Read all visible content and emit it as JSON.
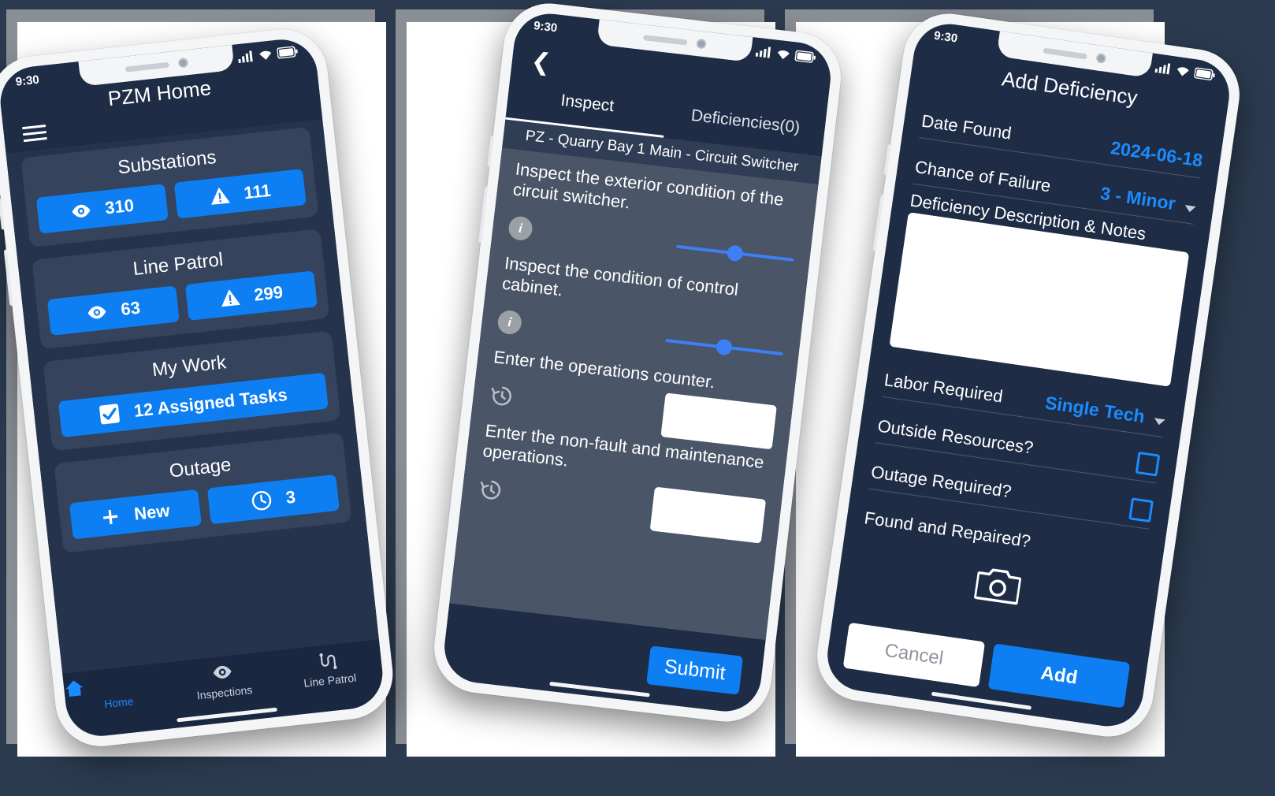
{
  "background": {
    "color": "#2b3a4f",
    "panel_color": "#ffffff"
  },
  "theme": {
    "accent": "#0d7ff2",
    "link": "#1a8cff",
    "screen_dark": "#1e2c45",
    "body_dark": "#4a5568"
  },
  "phones": [
    {
      "name": "pzm-home",
      "status": {
        "time": "9:30",
        "signal": "signal-icon",
        "wifi": "wifi-icon",
        "battery": "battery-icon"
      },
      "appbar": {
        "menu": "hamburger-icon",
        "title": "PZM Home"
      },
      "cards": [
        {
          "title": "Substations",
          "buttons": [
            {
              "icon": "eye-icon",
              "label": "310"
            },
            {
              "icon": "warning-icon",
              "label": "111"
            }
          ]
        },
        {
          "title": "Line Patrol",
          "buttons": [
            {
              "icon": "eye-icon",
              "label": "63"
            },
            {
              "icon": "warning-icon",
              "label": "299"
            }
          ]
        },
        {
          "title": "My Work",
          "buttons": [
            {
              "icon": "checkbox-icon",
              "label": "12 Assigned Tasks"
            }
          ]
        },
        {
          "title": "Outage",
          "buttons": [
            {
              "icon": "plus-icon",
              "label": "New"
            },
            {
              "icon": "clock-icon",
              "label": "3"
            }
          ]
        }
      ],
      "tabbar": [
        {
          "icon": "home-icon",
          "label": "Home",
          "active": true
        },
        {
          "icon": "eye-icon",
          "label": "Inspections",
          "active": false
        },
        {
          "icon": "line-patrol-icon",
          "label": "Line Patrol",
          "active": false
        }
      ]
    },
    {
      "name": "inspect",
      "status": {
        "time": "9:30"
      },
      "appbar": {
        "back": "back-chevron-icon"
      },
      "tabs": [
        {
          "label": "Inspect",
          "active": true
        },
        {
          "label": "Deficiencies(0)",
          "active": false
        }
      ],
      "subheader": "PZ - Quarry Bay 1 Main - Circuit Switcher",
      "questions": [
        {
          "text": "Inspect the exterior condition of the circuit switcher.",
          "icon": "info-icon",
          "control": "slider",
          "slider_value": 50
        },
        {
          "text": "Inspect the condition of control cabinet.",
          "icon": "info-icon",
          "control": "slider",
          "slider_value": 50
        },
        {
          "text": "Enter the operations counter.",
          "icon": "history-icon",
          "control": "text-input",
          "value": ""
        },
        {
          "text": "Enter the non-fault and maintenance operations.",
          "icon": "history-icon",
          "control": "text-input",
          "value": ""
        }
      ],
      "submit_label": "Submit"
    },
    {
      "name": "add-deficiency",
      "status": {
        "time": "9:30"
      },
      "title": "Add Deficiency",
      "fields": [
        {
          "label": "Date Found",
          "value": "2024-06-18",
          "control": "date"
        },
        {
          "label": "Chance of Failure",
          "value": "3 - Minor",
          "control": "dropdown"
        },
        {
          "label": "Deficiency Description & Notes",
          "value": "",
          "control": "textarea"
        },
        {
          "label": "Labor Required",
          "value": "Single Tech",
          "control": "dropdown"
        },
        {
          "label": "Outside Resources?",
          "value": "",
          "control": "checkbox",
          "checked": false
        },
        {
          "label": "Outage Required?",
          "value": "",
          "control": "checkbox",
          "checked": false
        },
        {
          "label": "Found and Repaired?",
          "value": "",
          "control": "checkbox",
          "checked": false
        }
      ],
      "camera_icon": "camera-icon",
      "cancel_label": "Cancel",
      "add_label": "Add"
    }
  ]
}
